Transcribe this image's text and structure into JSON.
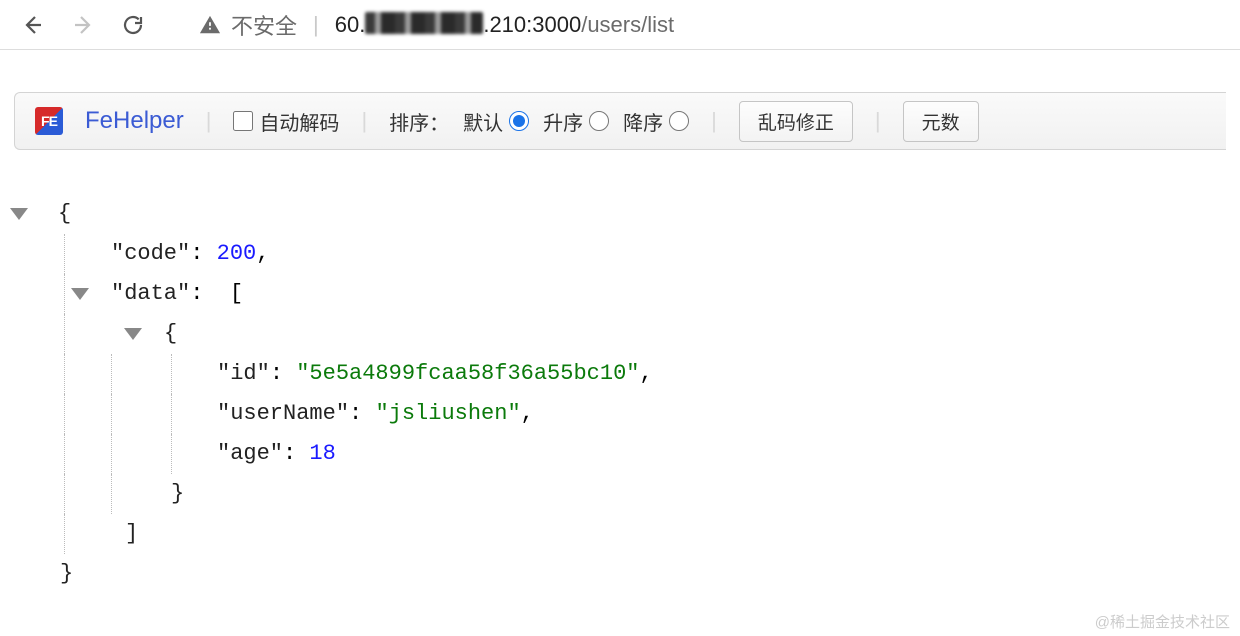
{
  "browser": {
    "not_secure_label": "不安全",
    "url_prefix": "60.",
    "url_suffix": ".210:3000",
    "url_path": "/users/list"
  },
  "ext": {
    "name": "FeHelper",
    "auto_decode": "自动解码",
    "sort_label": "排序：",
    "sort_default": "默认",
    "sort_asc": "升序",
    "sort_desc": "降序",
    "fix_btn": "乱码修正",
    "count_btn": "元数"
  },
  "json": {
    "k_code": "\"code\"",
    "v_code": "200",
    "k_data": "\"data\"",
    "k_id": "\"id\"",
    "v_id": "\"5e5a4899fcaa58f36a55bc10\"",
    "k_userName": "\"userName\"",
    "v_userName": "\"jsliushen\"",
    "k_age": "\"age\"",
    "v_age": "18"
  },
  "watermark": "@稀土掘金技术社区"
}
